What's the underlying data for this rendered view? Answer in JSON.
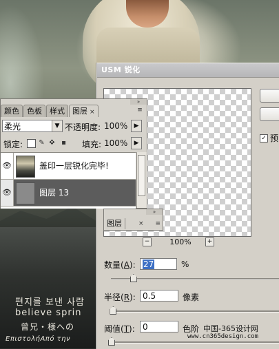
{
  "photo": {
    "line_korean": "편지를 보낸 사람",
    "line_english": "believe sprin",
    "line_japanese": "曾兄・様への",
    "line_greek": "ΕπιστολήΑπό την"
  },
  "usm_dialog": {
    "title": "USM 锐化",
    "preview_checkbox": {
      "label": "预",
      "checked": true
    },
    "zoom": {
      "minus": "−",
      "value": "100%",
      "plus": "+"
    },
    "amount": {
      "label": "数量(",
      "hotkey": "A",
      "label_end": "):",
      "value": "27",
      "unit": "%",
      "slider_fraction": 0.13
    },
    "radius": {
      "label": "半径(",
      "hotkey": "R",
      "label_end": "):",
      "value": "0.5",
      "unit": "像素",
      "slider_fraction": 0.01
    },
    "threshold": {
      "label": "阈值(",
      "hotkey": "T",
      "label_end": "):",
      "value": "0",
      "unit": "色阶",
      "slider_fraction": 0.0
    }
  },
  "layers_panel": {
    "tabs": [
      {
        "label": "颜色",
        "active": false
      },
      {
        "label": "色板",
        "active": false
      },
      {
        "label": "样式",
        "active": false
      },
      {
        "label": "图层",
        "active": true
      }
    ],
    "tab_close": "×",
    "menu_icon": "≡",
    "collapse_icon": "»",
    "blend_mode": "柔光",
    "opacity_label": "不透明度:",
    "opacity_value": "100%",
    "lock_label": "锁定:",
    "fill_label": "填充:",
    "fill_value": "100%",
    "layers": [
      {
        "name": "盖印一层锐化完毕!",
        "visible": true,
        "selected": false
      },
      {
        "name": "图层 13",
        "visible": true,
        "selected": true
      }
    ]
  },
  "mini_panel": {
    "tab": "图层",
    "close": "×",
    "menu": "≡",
    "collapse": "»"
  },
  "watermark": {
    "cn": "中国-365设计网",
    "url": "www.cn365design.com"
  }
}
